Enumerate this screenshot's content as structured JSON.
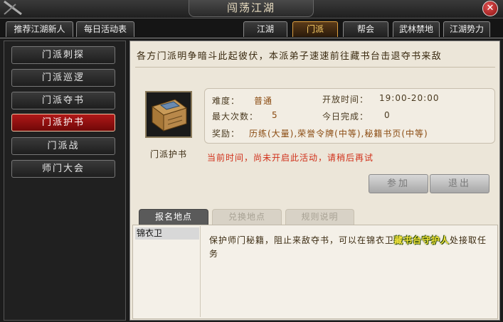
{
  "window": {
    "title": "闯荡江湖",
    "close_glyph": "✕"
  },
  "top_tabs": {
    "left": [
      "推荐江湖新人",
      "每日活动表"
    ],
    "right": [
      "江湖",
      "门派",
      "帮会",
      "武林禁地",
      "江湖势力"
    ],
    "active": "门派"
  },
  "sidebar": {
    "items": [
      "门派刺探",
      "门派巡逻",
      "门派夺书",
      "门派护书",
      "门派战",
      "师门大会"
    ],
    "active": "门派护书"
  },
  "main": {
    "intro": "各方门派明争暗斗此起彼伏，本派弟子速速前往藏书台击退夺书来敌",
    "item_name": "门派护书",
    "info": {
      "difficulty_label": "难度：",
      "difficulty_value": "普通",
      "open_time_label": "开放时间：",
      "open_time_value": "19:00-20:00",
      "max_count_label": "最大次数：",
      "max_count_value": "5",
      "today_done_label": "今日完成：",
      "today_done_value": "0",
      "reward_label": "奖励：",
      "reward_value": "历练(大量),荣誉令牌(中等),秘籍书页(中等)"
    },
    "notice": "当前时间，尚未开启此活动，请稍后再试",
    "buttons": {
      "join": "参加",
      "exit": "退出"
    },
    "subtabs": [
      "报名地点",
      "兑换地点",
      "规则说明"
    ],
    "active_subtab": "报名地点",
    "location": "锦衣卫",
    "description": {
      "before": "保护师门秘籍，阻止来敌夺书，可以在锦衣卫",
      "highlight": "藏书台守护人",
      "after": "处接取任务"
    }
  }
}
